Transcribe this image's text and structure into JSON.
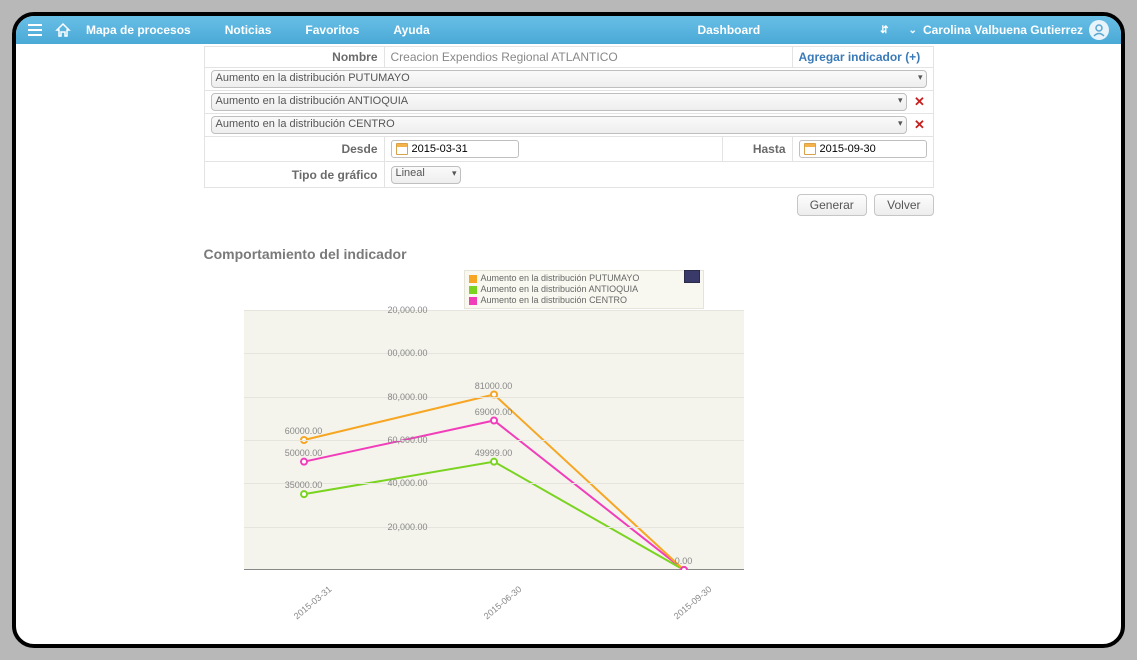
{
  "nav": {
    "links": [
      "Mapa de procesos",
      "Noticias",
      "Favoritos",
      "Ayuda"
    ],
    "dashboard": "Dashboard",
    "user": "Carolina Valbuena Gutierrez"
  },
  "form": {
    "nombre_label": "Nombre",
    "nombre_value": "Creacion Expendios Regional ATLANTICO",
    "add_link": "Agregar indicador (+)",
    "indicators": [
      {
        "label": "Aumento en la distribución PUTUMAYO",
        "removable": false
      },
      {
        "label": "Aumento en la distribución ANTIOQUIA",
        "removable": true
      },
      {
        "label": "Aumento en la distribución CENTRO",
        "removable": true
      }
    ],
    "desde_label": "Desde",
    "desde_value": "2015-03-31",
    "hasta_label": "Hasta",
    "hasta_value": "2015-09-30",
    "tipo_label": "Tipo de gráfico",
    "tipo_value": "Lineal",
    "btn_generar": "Generar",
    "btn_volver": "Volver"
  },
  "chart_title": "Comportamiento del indicador",
  "chart_data": {
    "type": "line",
    "title": "Comportamiento del indicador",
    "xlabel": "",
    "ylabel": "",
    "ylim": [
      0,
      120000
    ],
    "yticks": [
      20000,
      40000,
      60000,
      80000,
      100000,
      120000
    ],
    "ytick_labels": [
      "20,000.00",
      "40,000.00",
      "60,000.00",
      "80,000.00",
      "00,000.00",
      "20,000.00"
    ],
    "categories": [
      "2015-03-31",
      "2015-06-30",
      "2015-09-30"
    ],
    "series": [
      {
        "name": "Aumento en la distribución PUTUMAYO",
        "color": "#f6a623",
        "values": [
          60000.0,
          81000.0,
          0.0
        ]
      },
      {
        "name": "Aumento en la distribución ANTIOQUIA",
        "color": "#7bd321",
        "values": [
          35000.0,
          49999.0,
          0.0
        ]
      },
      {
        "name": "Aumento en la distribución CENTRO",
        "color": "#f23dbb",
        "values": [
          50000.0,
          69000.0,
          0.0
        ]
      }
    ],
    "data_labels": {
      "PUTUMAYO": [
        "60000.00",
        "81000.00",
        "0.00"
      ],
      "ANTIOQUIA": [
        "35000.00",
        "49999.00",
        ""
      ],
      "CENTRO": [
        "50000.00",
        "69000.00",
        ""
      ]
    }
  }
}
